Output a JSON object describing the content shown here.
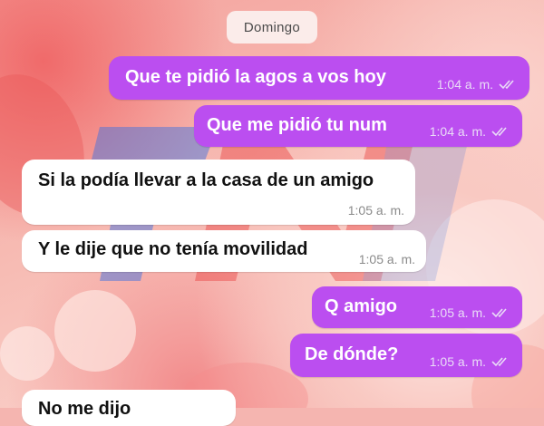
{
  "date_separator": "Domingo",
  "messages": [
    {
      "direction": "outgoing",
      "text": "Que te pidió la agos a vos hoy",
      "time": "1:04 a. m.",
      "status_icon": "double-check-icon"
    },
    {
      "direction": "outgoing",
      "text": "Que me pidió tu num",
      "time": "1:04 a. m.",
      "status_icon": "double-check-icon"
    },
    {
      "direction": "incoming",
      "text": "Si la podía llevar a la casa de un amigo",
      "time": "1:05 a. m."
    },
    {
      "direction": "incoming",
      "text": "Y le dije que no tenía movilidad",
      "time": "1:05 a. m."
    },
    {
      "direction": "outgoing",
      "text": "Q amigo",
      "time": "1:05 a. m.",
      "status_icon": "double-check-icon"
    },
    {
      "direction": "outgoing",
      "text": "De dónde?",
      "time": "1:05 a. m.",
      "status_icon": "double-check-icon"
    },
    {
      "direction": "incoming",
      "text": "No me dijo",
      "time": ""
    }
  ],
  "watermark_logo": "TN",
  "colors": {
    "outgoing_bubble": "#bb4ef0",
    "incoming_bubble": "#ffffff",
    "wallpaper": "#f5b5b0",
    "watermark_blue": "#3a6fe0",
    "watermark_red": "#e83a3a"
  }
}
